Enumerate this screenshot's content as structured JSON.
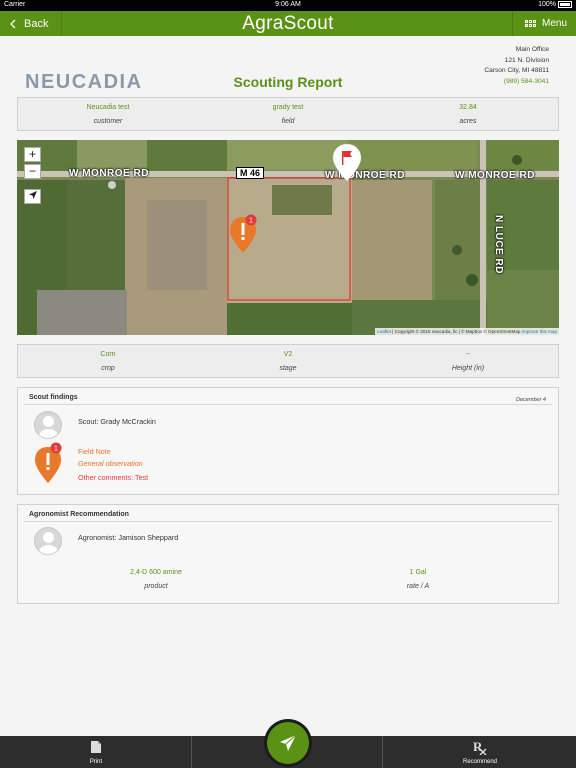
{
  "status_bar": {
    "carrier": "Carrier",
    "time": "9:06 AM",
    "battery": "100%"
  },
  "nav": {
    "back_label": "Back",
    "title": "AgraScout",
    "menu_label": "Menu"
  },
  "company": {
    "logo_text": "NEUCADIA",
    "address_lines": [
      "Main Office",
      "121 N. Division",
      "Carson City, MI 48811"
    ],
    "phone": "(989) 584-3041"
  },
  "report_title": "Scouting Report",
  "summary": [
    {
      "value": "Neucadia test",
      "label": "customer"
    },
    {
      "value": "grady test",
      "label": "field"
    },
    {
      "value": "32.84",
      "label": "acres"
    }
  ],
  "map": {
    "zoom_in": "+",
    "zoom_out": "−",
    "roads": [
      "W MONROE RD",
      "W MONROE RD",
      "W MONROE RD",
      "N LUCE RD"
    ],
    "highway": "M 46",
    "marker_badge": "1",
    "attribution": {
      "leaflet": "Leaflet",
      "copyright": " | Copyright © 2015 neucadia, llc | © Mapbox © OpenStreetMap ",
      "improve": "Improve this map"
    },
    "colors": {
      "field_boundary": "#e03030",
      "field_note_pin": "#e8782a"
    }
  },
  "crop_info": [
    {
      "value": "Corn",
      "label": "crop"
    },
    {
      "value": "V2",
      "label": "stage"
    },
    {
      "value": "--",
      "label": "Height (in)"
    }
  ],
  "scout_findings": {
    "header": "Scout findings",
    "date": "December 4",
    "scout_label": "Scout: Grady McCrackin",
    "note_badge": "1",
    "note_title": "Field Note",
    "note_subtitle": "General observation",
    "note_comment": "Other comments: Test"
  },
  "agronomist": {
    "header": "Agronomist Recommendation",
    "name_label": "Agronomist: Jamison Sheppard",
    "product_value": "2,4-D 600 amine",
    "product_label": "product",
    "rate_value": "1 Gal",
    "rate_label": "rate / A"
  },
  "toolbar": {
    "print_label": "Print",
    "recommend_label": "Recommend",
    "send_icon": "send-icon"
  },
  "theme": {
    "accent": "#5a9216",
    "note_orange": "#e8782a",
    "warning_red": "#e23b3b"
  }
}
